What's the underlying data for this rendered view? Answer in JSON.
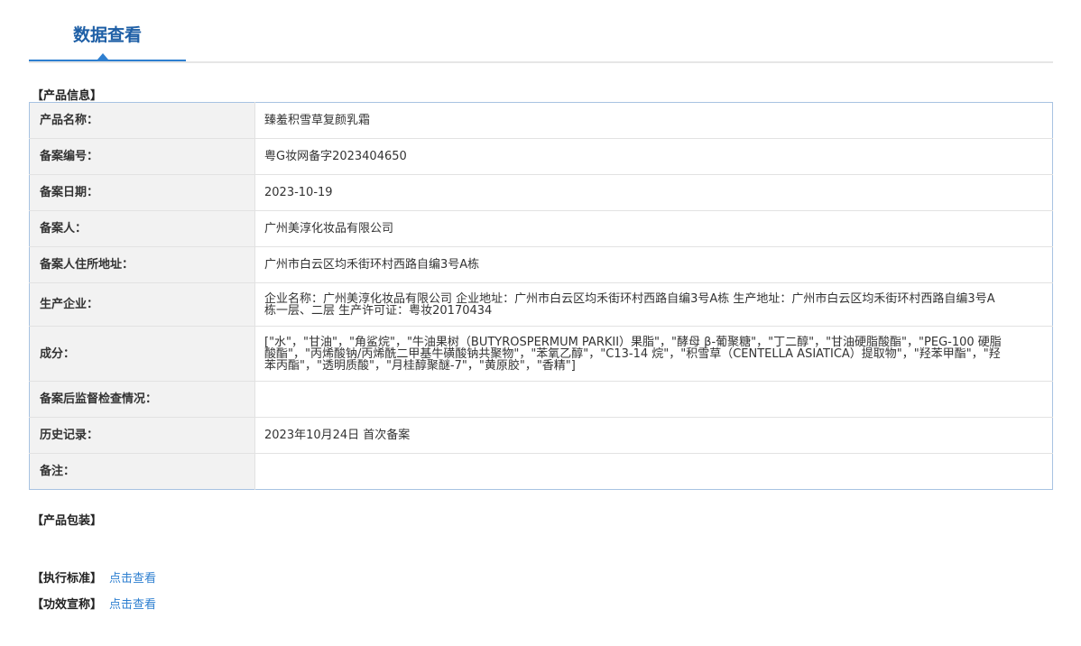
{
  "tabs": [
    {
      "label": "数据查看",
      "active": true
    }
  ],
  "sections": {
    "product_info": "【产品信息】",
    "product_packaging": "【产品包装】"
  },
  "product_info": {
    "rows": [
      {
        "label": "产品名称：",
        "value": "臻羞积雪草复颜乳霜"
      },
      {
        "label": "备案编号：",
        "value": "粤G妆网备字2023404650"
      },
      {
        "label": "备案日期：",
        "value": "2023-10-19"
      },
      {
        "label": "备案人：",
        "value": "广州美淳化妆品有限公司"
      },
      {
        "label": "备案人住所地址：",
        "value": "广州市白云区均禾街环村西路自编3号A栋"
      },
      {
        "label": "生产企业：",
        "value": "企业名称：广州美淳化妆品有限公司 企业地址：广州市白云区均禾街环村西路自编3号A栋 生产地址：广州市白云区均禾街环村西路自编3号A栋一层、二层 生产许可证：粤妆20170434"
      },
      {
        "label": "成分：",
        "value": "[\"水\"，\"甘油\"，\"角鲨烷\"，\"牛油果树（BUTYROSPERMUM PARKII）果脂\"，\"酵母 β-葡聚糖\"，\"丁二醇\"，\"甘油硬脂酸酯\"，\"PEG-100 硬脂酸酯\"，\"丙烯酸钠/丙烯酰二甲基牛磺酸钠共聚物\"，\"苯氧乙醇\"，\"C13-14 烷\"，\"积雪草（CENTELLA ASIATICA）提取物\"，\"羟苯甲酯\"，\"羟苯丙酯\"，\"透明质酸\"，\"月桂醇聚醚-7\"，\"黄原胶\"，\"香精\"]"
      },
      {
        "label": "备案后监督检查情况：",
        "value": ""
      },
      {
        "label": "历史记录：",
        "value": "2023年10月24日 首次备案"
      },
      {
        "label": "备注：",
        "value": ""
      }
    ]
  },
  "links": {
    "standard": {
      "label": "【执行标准】",
      "link_text": "点击查看"
    },
    "efficacy": {
      "label": "【功效宣称】",
      "link_text": "点击查看"
    }
  },
  "colors": {
    "accent": "#2e7fd0",
    "tab_text": "#1e5fa6",
    "table_border": "#a8c3e2",
    "label_bg": "#f2f2f2"
  }
}
